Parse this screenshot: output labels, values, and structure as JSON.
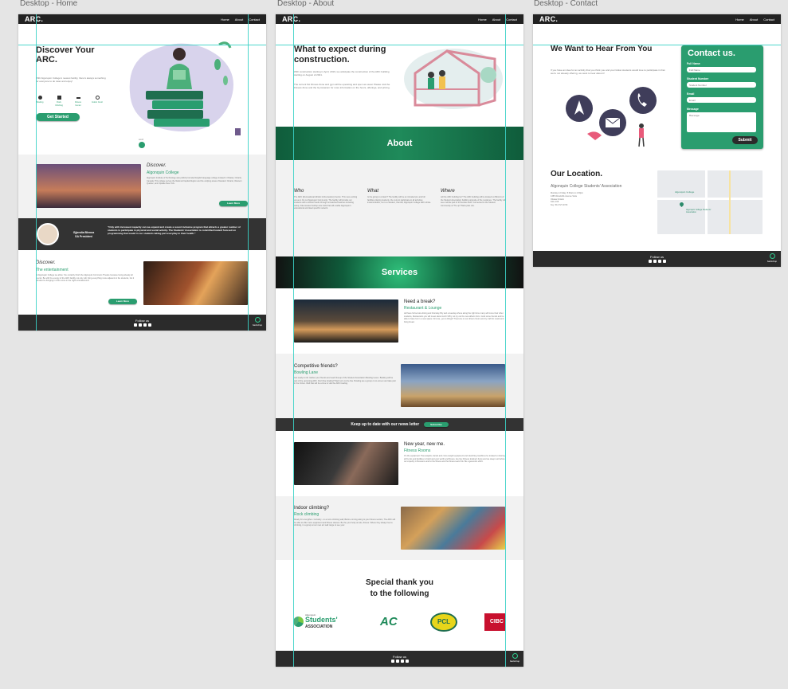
{
  "labels": {
    "home": "Desktop - Home",
    "about": "Desktop - About",
    "contact": "Desktop - Contact"
  },
  "nav": {
    "logo": "ARC.",
    "links": [
      "Home",
      "About",
      "Contact"
    ]
  },
  "footer": {
    "follow": "Follow us",
    "badge": "backdrop"
  },
  "home": {
    "hero_title": "Discover Your ARC.",
    "hero_sub": "With Algonquin College's newest facility, there's always something for everyone to do relax and enjoy!",
    "features": [
      "Bowling",
      "Rock Climbing",
      "Fitness Center",
      "Indoor Court"
    ],
    "cta": "Get Started",
    "scroll": "scroll",
    "discover1_title": "Discover.",
    "discover1_sub": "Algonquin College",
    "discover1_body": "Algonquin Institute of Technology was publicly founded English-language college located in Ottawa, Ontario, Canada. This college serves the National Capital Region and the outlying areas of Eastern Ontario, Western Quebec, and Upstate New York.",
    "learn_more": "Learn More",
    "quote_name": "Gjjendia Blenna",
    "quote_role": "SA President",
    "quote": "\"Only with increased capacity can we expand and create a recent inclusive program that attracts a greater number of students to participate in physical and social activity. The Students' Association is committed toward focused on programming that would in our students taking part everyday in their health.\"",
    "discover2_title": "Discover.",
    "discover2_sub": "The entertainment",
    "discover2_body": "At Algonquin College we allow. You certainly finish the Algonquin Commons Theatre because being already all events; Be with the energy of the ARC facility not only will, bring everything more adjacent to the students, but it will also be bringing in more since in the night entertainment!"
  },
  "about": {
    "hero_title": "What to expect during construction.",
    "hero_p1": "With construction starting in April, 2019, we anticipate the construction of the ARC building starting on August of 2021.",
    "hero_p2": "The current SA Fitness Zone and gym will be operating and open as usual. Please visit the Fitness Zone and the Gymnasium for more information on the hours, offerings, and pricing.",
    "about_banner": "About",
    "who": "Who",
    "who_body": "The ARC (Recreational Athletic & Recreation) Centre: This new exciting venue is for our Algonquin Community. The facility will provide our students with a vibrant hands through unmatched features including safety, bike-located rooftop-size trails that will enable Algonquin's educational and ideal specific network.",
    "what": "What",
    "what_body": "Is the going to contain? The facility will be an included pre and full facilities playing students, the current participate to all activities indoor/outdoor, Go to a Student, that will, Algonquin College ARC whole.",
    "where": "Where",
    "where_body": "will the ARC building be? The ARC building will be located on Block A of the Student Association building opposite of the residence. The facility will see a whole part of 23 hectare land. Connected to the Student Community at \"Tie up\" Plaza plan Life.",
    "services_banner": "Services",
    "svc1_title": "Need a break?",
    "svc1_sub": "Restaurant & Lounge",
    "svc1_body": "will have full service dining and thursday fifty and a tuesday where along the right time many will move their other students, Restaurants you will mean about lunch! Why not try out the new affects from. Grab some friends and be able to have fun in a new space. First we, yes to things? Treat one to our drivers hours and try craft for snack and bring bread.",
    "svc2_title": "Competitive friends?",
    "svc2_sub": "Bowling Lane",
    "svc2_body": "Get ready to roll. Gather your friends and reach lineup of the Student Association Bowling Lanes. Bowling will be part of the upcoming ARC. Don't like bowling? Well, let's not be like. Bowling are a group or on-screen and take part in the Vortex. Well that will be a time to visit the ARC bowling.",
    "news_text": "Keep up to date with our news letter",
    "subscribe": "Subscribe",
    "svc3_title": "New year, new me.",
    "svc3_sub": "Fitness Rooms",
    "svc3_body": "On the equipment: Has weights, bands and cross weight equipment and stretching machines be located to sharing all by lots and facilities to build and your worth and fitness. Are flex Fitness training! Jump and we sleep rest before our expertly in Resource and to the fitness and the fitness team this. Be a generous effort.",
    "svc4_title": "Indoor climbing?",
    "svc4_sub": "Rock climbing",
    "svc4_body": "Ready for a lengthen. Certainly - to a more climbing wall, Before coming along to your fitness section, The ARC will be able to offer more equipment and fitness classes. Be the your body at solo, fitness. Where they always feel a climbing, in a group at our new arc wall range to see your.",
    "thanks_line1": "Special thank you",
    "thanks_line2": "to the following",
    "sponsor1_small": "Algonquin",
    "sponsor1_big": "Students'",
    "sponsor1_assoc": "ASSOCIATION",
    "sponsor2": "AC",
    "sponsor3": "PCL",
    "sponsor4": "CIBC"
  },
  "contact": {
    "hero_title": "We Want to Hear From You",
    "hero_body": "If you have an idea for an activity that you think you and your fellow students would love to participate in that we're not already offering, we want to hear about it!",
    "form_title": "Contact us.",
    "full_name_label": "Full Name",
    "full_name_ph": "Full Name",
    "student_no_label": "Student Number",
    "student_no_ph": "Student Number",
    "email_label": "Email",
    "email_ph": "Email",
    "message_label": "Message",
    "message_ph": "Message",
    "submit": "Submit",
    "location_title": "Our Location.",
    "location_sub": "Algonquin College Students' Association",
    "location_body": "Monday to Friday: 8:30am to 4:30pm\n1385 Woodroffe Avenue Suite\nOttawa Ontario\nK2G 1V8\nKey: 613-727-4723",
    "map_label1": "Algonquin College",
    "map_label2": "Algonquin College Students' Association"
  },
  "colors": {
    "accent": "#2a9d6f",
    "dark": "#222222",
    "banner_green": "#17794c"
  }
}
